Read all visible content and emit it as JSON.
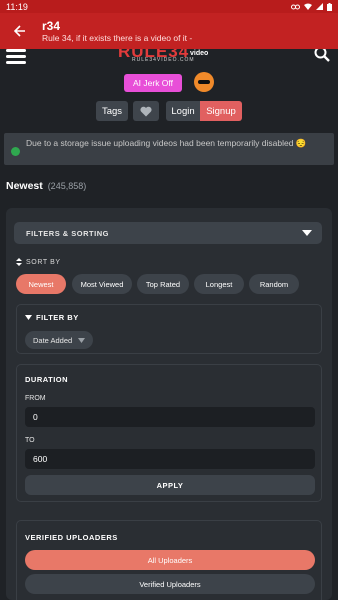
{
  "status_bar": {
    "time": "11:19"
  },
  "app_bar": {
    "title": "r34",
    "url": "Rule 34, if it exists there is a video of it -"
  },
  "logo": {
    "main": "RULE34",
    "tag": "video",
    "sub": "RULE34VIDEO.COM"
  },
  "header": {
    "ai_button": "AI Jerk Off",
    "tags": "Tags",
    "login": "Login",
    "signup": "Signup"
  },
  "notice": {
    "text": "Due to a storage issue uploading videos had been temporarily disabled",
    "emoji": "😔"
  },
  "listing": {
    "title": "Newest",
    "count": "(245,858)"
  },
  "filters": {
    "toggle_label": "FILTERS & SORTING",
    "sort_by_label": "SORT BY",
    "sort_options": [
      "Newest",
      "Most Viewed",
      "Top Rated",
      "Longest",
      "Random"
    ],
    "filter_by_label": "FILTER BY",
    "filter_by_value": "Date Added",
    "duration": {
      "title": "DURATION",
      "from_label": "FROM",
      "from_value": "0",
      "to_label": "TO",
      "to_value": "600",
      "apply": "APPLY"
    },
    "verified": {
      "title": "VERIFIED UPLOADERS",
      "all": "All Uploaders",
      "verified": "Verified Uploaders"
    }
  },
  "colors": {
    "accent": "#e87868",
    "appbar": "#c22222",
    "ai_button": "#e84fd8",
    "background": "#1f2226"
  }
}
